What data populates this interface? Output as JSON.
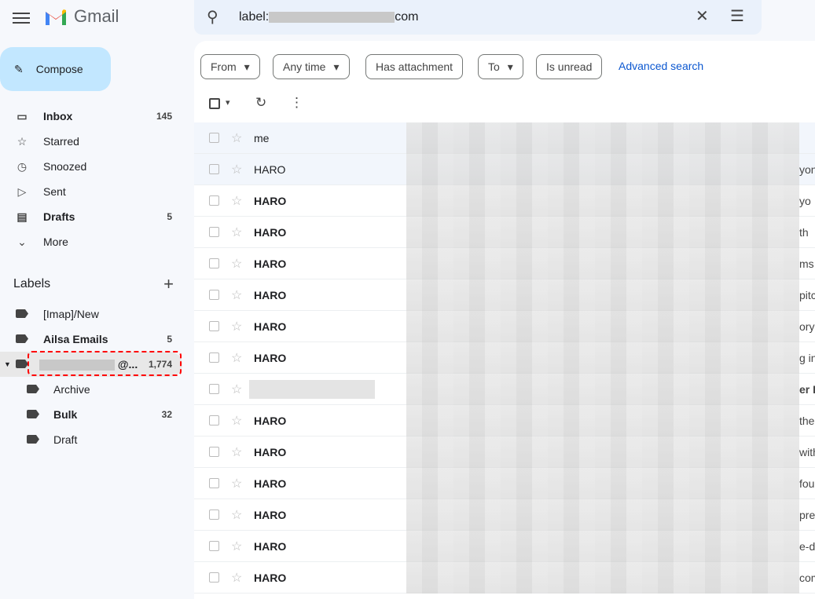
{
  "app": {
    "name": "Gmail"
  },
  "search": {
    "query_prefix": "label:",
    "query_suffix": "com"
  },
  "compose": {
    "label": "Compose"
  },
  "nav": [
    {
      "label": "Inbox",
      "count": "145",
      "icon": "inbox-icon",
      "bold": true
    },
    {
      "label": "Starred",
      "count": "",
      "icon": "star-icon"
    },
    {
      "label": "Snoozed",
      "count": "",
      "icon": "clock-icon"
    },
    {
      "label": "Sent",
      "count": "",
      "icon": "send-icon"
    },
    {
      "label": "Drafts",
      "count": "5",
      "icon": "draft-icon",
      "bold": true
    },
    {
      "label": "More",
      "count": "",
      "icon": "chevron-down-icon"
    }
  ],
  "labels": {
    "title": "Labels",
    "items": [
      {
        "label": "[Imap]/New",
        "count": ""
      },
      {
        "label": "Ailsa Emails",
        "count": "5"
      },
      {
        "label": "@...",
        "count": "1,774"
      },
      {
        "label": "Archive",
        "count": ""
      },
      {
        "label": "Bulk",
        "count": "32"
      },
      {
        "label": "Draft",
        "count": ""
      }
    ]
  },
  "filters": {
    "from": "From",
    "any_time": "Any time",
    "has_attachment": "Has attachment",
    "to": "To",
    "is_unread": "Is unread",
    "advanced": "Advanced search"
  },
  "emails": [
    {
      "sender": "me",
      "snippet": "",
      "read": true
    },
    {
      "sender": "HARO",
      "snippet": "yon",
      "read": true
    },
    {
      "sender": "HARO",
      "snippet": "yo"
    },
    {
      "sender": "HARO",
      "snippet": "th"
    },
    {
      "sender": "HARO",
      "snippet": "ms"
    },
    {
      "sender": "HARO",
      "snippet": "pitc"
    },
    {
      "sender": "HARO",
      "snippet": "ory"
    },
    {
      "sender": "HARO",
      "snippet": "g in"
    },
    {
      "sender": "",
      "snippet": "er B"
    },
    {
      "sender": "HARO",
      "snippet": "the"
    },
    {
      "sender": "HARO",
      "snippet": "with"
    },
    {
      "sender": "HARO",
      "snippet": "fou"
    },
    {
      "sender": "HARO",
      "snippet": "pre"
    },
    {
      "sender": "HARO",
      "snippet": "e-d"
    },
    {
      "sender": "HARO",
      "snippet": "com"
    }
  ],
  "colors": {
    "accent": "#0b57d0",
    "compose": "#c2e7ff",
    "highlight": "#ff0000"
  }
}
